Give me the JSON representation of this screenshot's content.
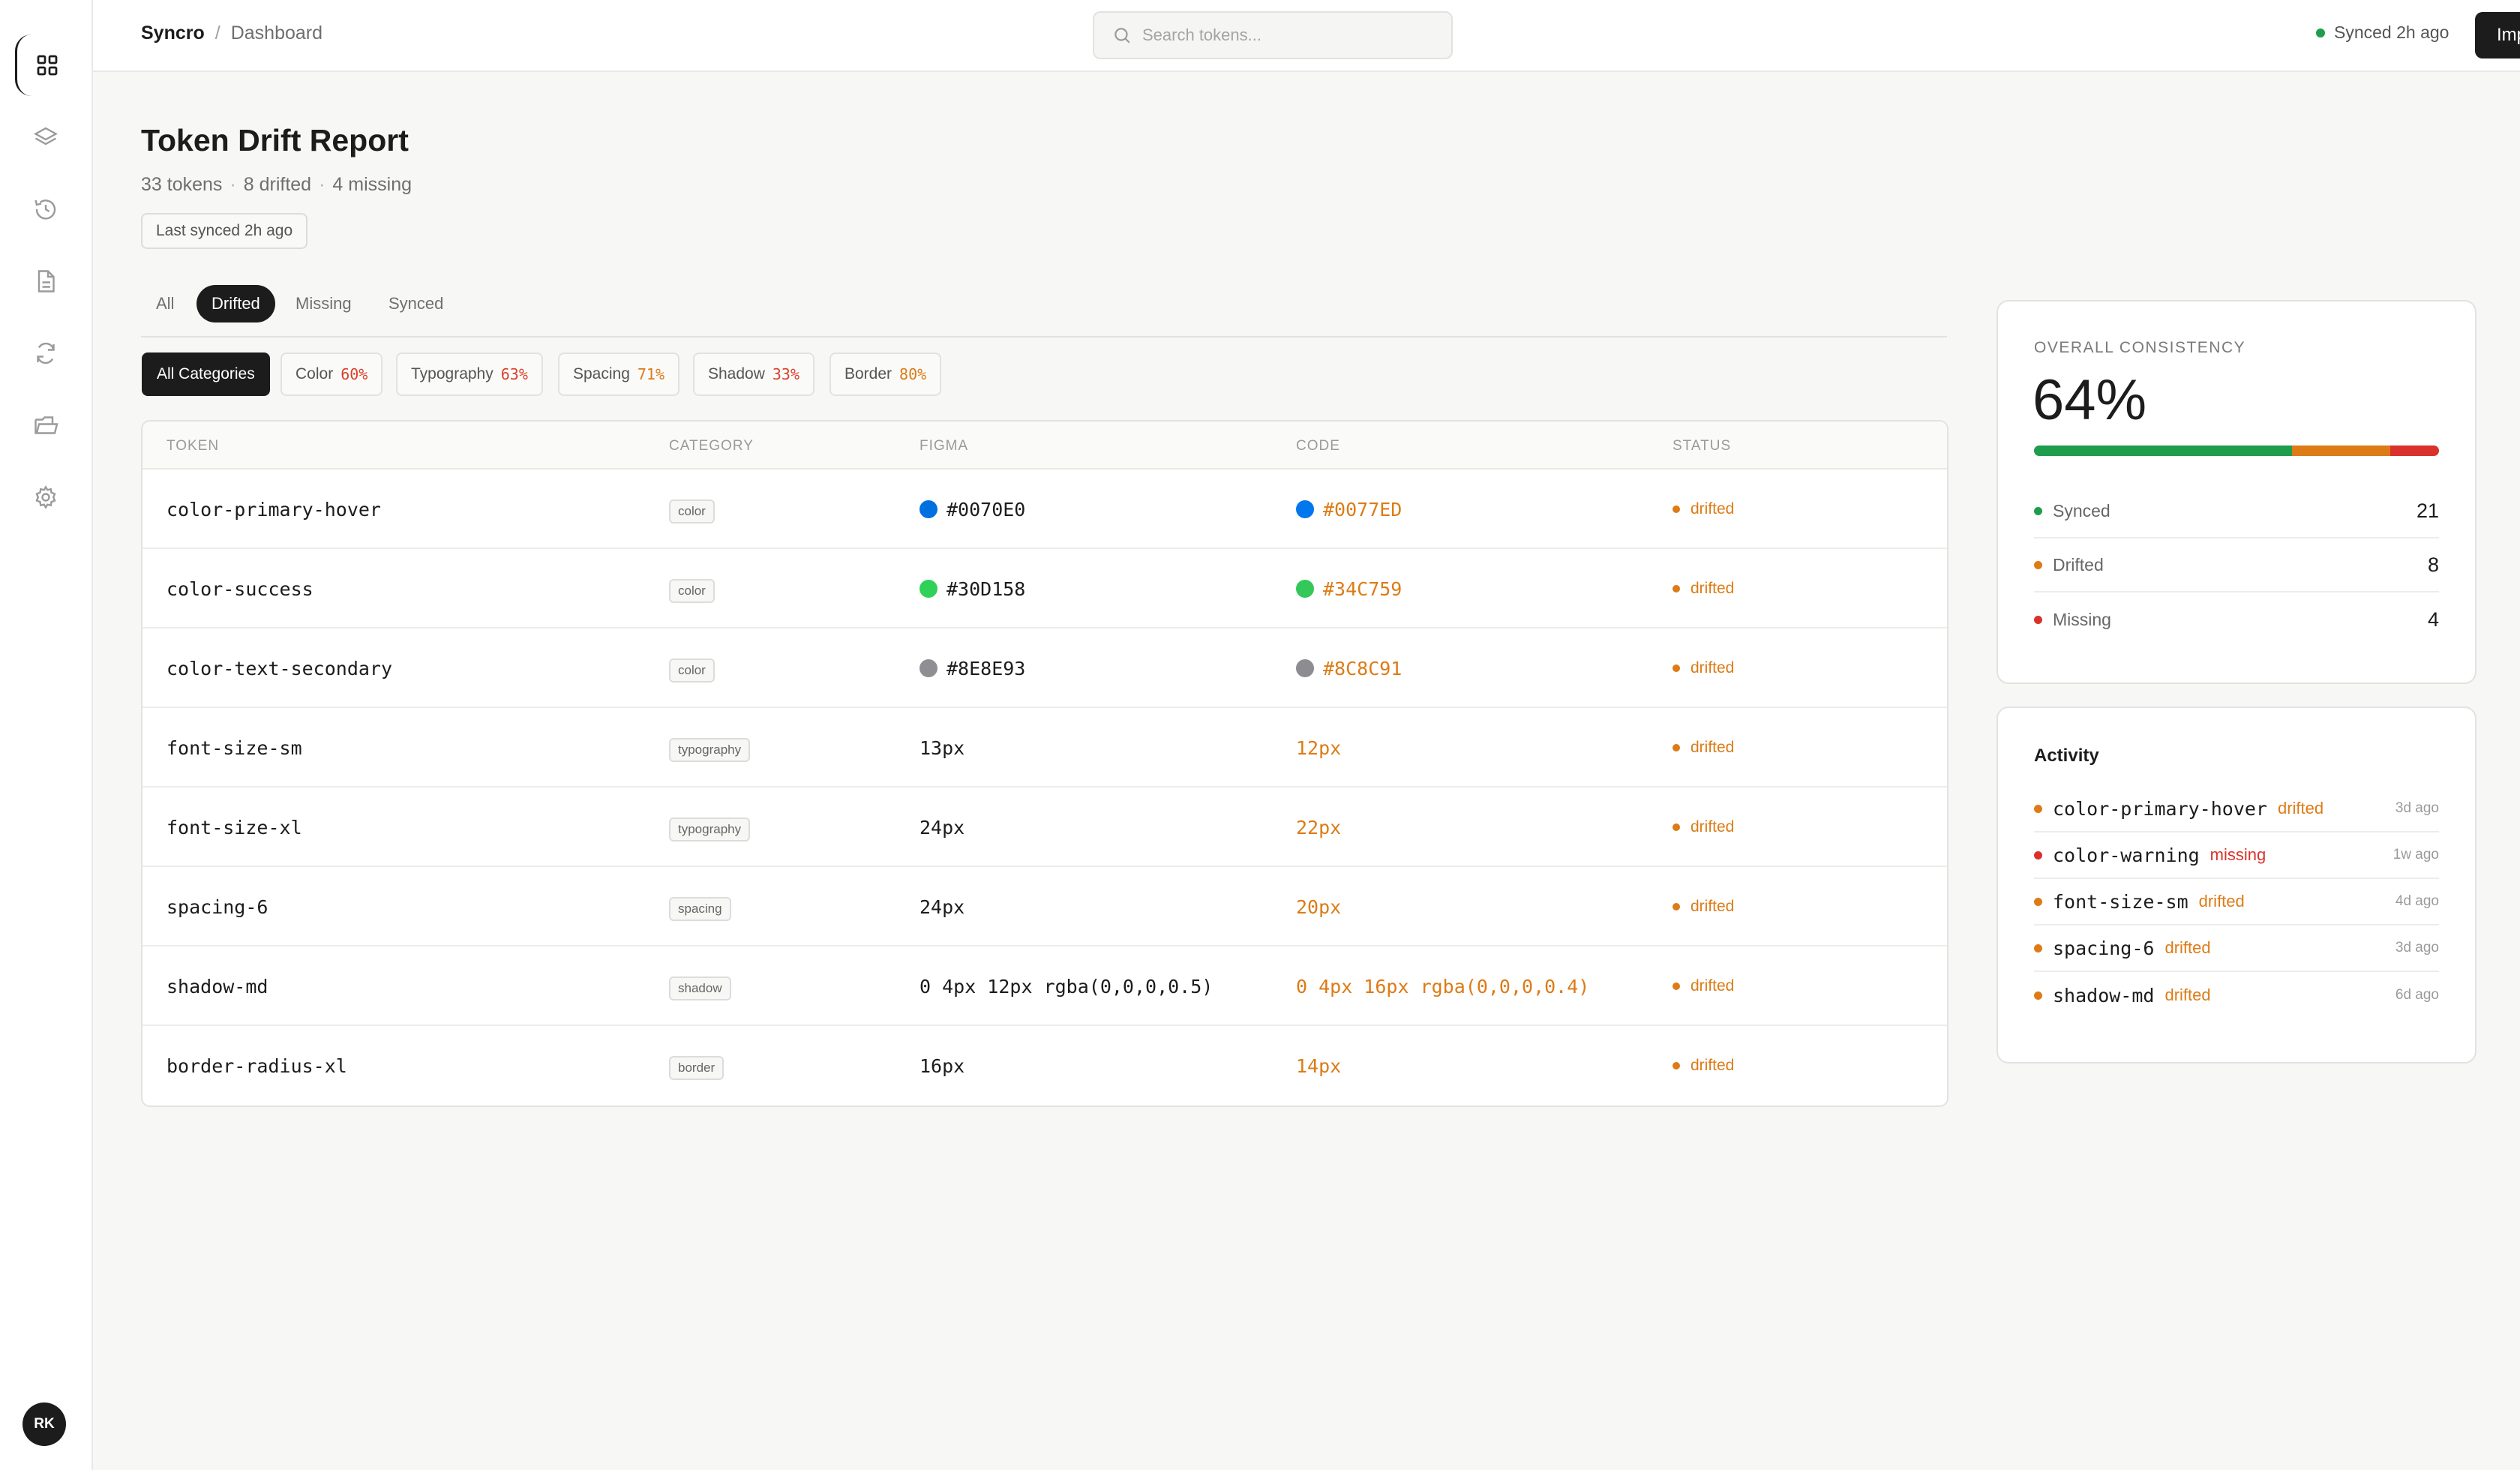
{
  "app": {
    "brand": "Syncro",
    "page": "Dashboard",
    "breadcrumb_sep": "/"
  },
  "search": {
    "placeholder": "Search tokens..."
  },
  "sync_status": {
    "text": "Synced 2h ago",
    "color": "#1f9d4d"
  },
  "import_button": {
    "label": "Import"
  },
  "sidebar": {
    "icons": [
      "grid-icon",
      "layers-icon",
      "history-icon",
      "document-icon",
      "sync-icon",
      "folder-icon",
      "settings-icon"
    ],
    "avatar": "RK"
  },
  "report": {
    "title": "Token Drift Report",
    "summary": {
      "tokens": "33 tokens",
      "drifted": "8 drifted",
      "missing": "4 missing",
      "sep": "·"
    },
    "last_synced": "Last synced 2h ago"
  },
  "tabs": [
    {
      "label": "All",
      "active": false
    },
    {
      "label": "Drifted",
      "active": true
    },
    {
      "label": "Missing",
      "active": false
    },
    {
      "label": "Synced",
      "active": false
    }
  ],
  "categories": [
    {
      "label": "All Categories",
      "pct": "",
      "active": true
    },
    {
      "label": "Color",
      "pct": "60%",
      "pct_color": "#d9412b"
    },
    {
      "label": "Typography",
      "pct": "63%",
      "pct_color": "#d9412b"
    },
    {
      "label": "Spacing",
      "pct": "71%",
      "pct_color": "#dd7b16"
    },
    {
      "label": "Shadow",
      "pct": "33%",
      "pct_color": "#d9412b"
    },
    {
      "label": "Border",
      "pct": "80%",
      "pct_color": "#dd7b16"
    }
  ],
  "table": {
    "headers": {
      "token": "TOKEN",
      "category": "CATEGORY",
      "figma": "FIGMA",
      "code": "CODE",
      "status": "STATUS"
    },
    "rows": [
      {
        "token": "color-primary-hover",
        "category": "color",
        "figma": "#0070E0",
        "figma_swatch": "#0070E0",
        "code": "#0077ED",
        "code_swatch": "#0077ED",
        "status": "drifted"
      },
      {
        "token": "color-success",
        "category": "color",
        "figma": "#30D158",
        "figma_swatch": "#30D158",
        "code": "#34C759",
        "code_swatch": "#34C759",
        "status": "drifted"
      },
      {
        "token": "color-text-secondary",
        "category": "color",
        "figma": "#8E8E93",
        "figma_swatch": "#8E8E93",
        "code": "#8C8C91",
        "code_swatch": "#8C8C91",
        "status": "drifted"
      },
      {
        "token": "font-size-sm",
        "category": "typography",
        "figma": "13px",
        "code": "12px",
        "status": "drifted"
      },
      {
        "token": "font-size-xl",
        "category": "typography",
        "figma": "24px",
        "code": "22px",
        "status": "drifted"
      },
      {
        "token": "spacing-6",
        "category": "spacing",
        "figma": "24px",
        "code": "20px",
        "status": "drifted"
      },
      {
        "token": "shadow-md",
        "category": "shadow",
        "figma": "0 4px 12px rgba(0,0,0,0.5)",
        "code": "0 4px 16px rgba(0,0,0,0.4)",
        "status": "drifted"
      },
      {
        "token": "border-radius-xl",
        "category": "border",
        "figma": "16px",
        "code": "14px",
        "status": "drifted"
      }
    ]
  },
  "consistency": {
    "label": "OVERALL CONSISTENCY",
    "value": "64%",
    "bar": [
      {
        "fraction": 0.6364,
        "color": "#1f9d4d"
      },
      {
        "fraction": 0.2424,
        "color": "#dd7b16"
      },
      {
        "fraction": 0.1212,
        "color": "#d9312b"
      }
    ],
    "legend": [
      {
        "label": "Synced",
        "count": "21",
        "color": "#1f9d4d"
      },
      {
        "label": "Drifted",
        "count": "8",
        "color": "#dd7b16"
      },
      {
        "label": "Missing",
        "count": "4",
        "color": "#d9312b"
      }
    ]
  },
  "activity": {
    "title": "Activity",
    "items": [
      {
        "token": "color-primary-hover",
        "state": "drifted",
        "color": "#dd7b16",
        "time": "3d ago"
      },
      {
        "token": "color-warning",
        "state": "missing",
        "color": "#d9312b",
        "time": "1w ago"
      },
      {
        "token": "font-size-sm",
        "state": "drifted",
        "color": "#dd7b16",
        "time": "4d ago"
      },
      {
        "token": "spacing-6",
        "state": "drifted",
        "color": "#dd7b16",
        "time": "3d ago"
      },
      {
        "token": "shadow-md",
        "state": "drifted",
        "color": "#dd7b16",
        "time": "6d ago"
      }
    ]
  },
  "colors": {
    "drifted": "#dd7b16",
    "missing": "#d9312b",
    "synced": "#1f9d4d",
    "dark": "#1c1c1c"
  }
}
